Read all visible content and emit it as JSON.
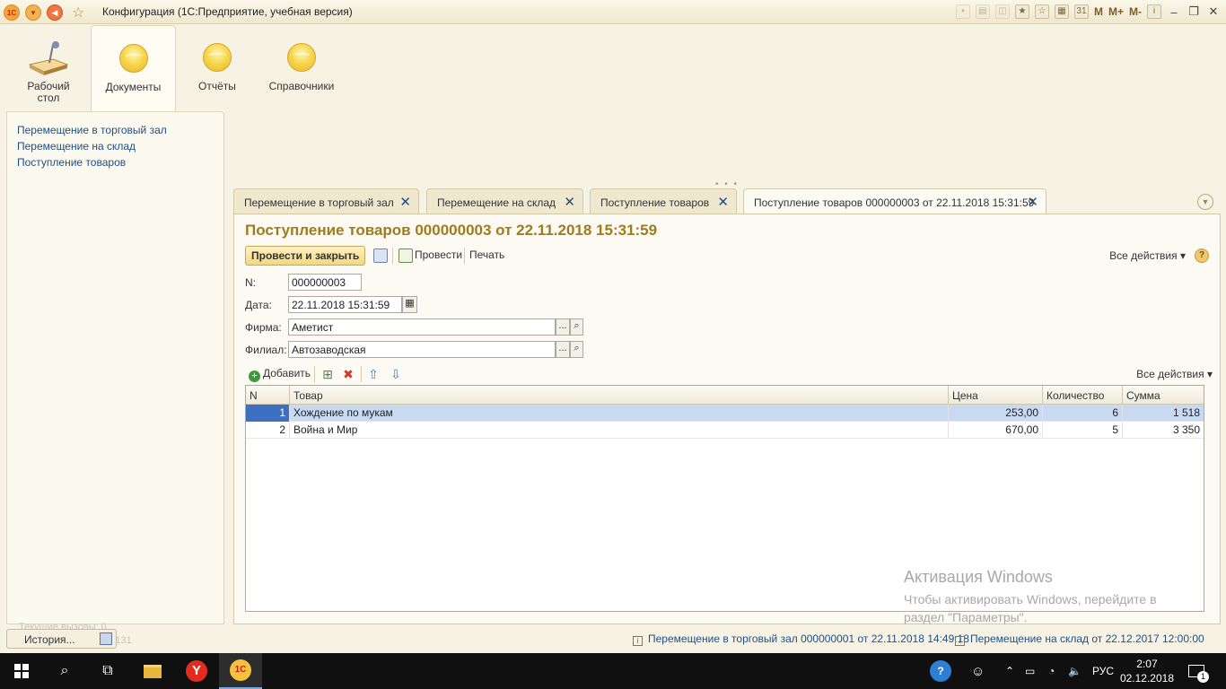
{
  "window": {
    "title": "Конфигурация  (1С:Предприятие, учебная версия)"
  },
  "toolbar_right": {
    "m": "M",
    "m_plus": "M+",
    "m_minus": "M-"
  },
  "sections": [
    {
      "label": "Рабочий стол"
    },
    {
      "label": "Документы"
    },
    {
      "label": "Отчёты"
    },
    {
      "label": "Справочники"
    }
  ],
  "nav_links": [
    "Перемещение в торговый зал",
    "Перемещение на склад",
    "Поступление товаров"
  ],
  "tabs": [
    "Перемещение в торговый зал",
    "Перемещение на склад",
    "Поступление товаров",
    "Поступление товаров 000000003 от 22.11.2018 15:31:59"
  ],
  "document": {
    "title": "Поступление товаров 000000003 от 22.11.2018 15:31:59",
    "commands": {
      "post_close": "Провести и закрыть",
      "post": "Провести",
      "print": "Печать",
      "all_actions": "Все действия ▾"
    },
    "fields": {
      "number_label": "N:",
      "number": "000000003",
      "date_label": "Дата:",
      "date": "22.11.2018 15:31:59",
      "firm_label": "Фирма:",
      "firm": "Аметист",
      "branch_label": "Филиал:",
      "branch": "Автозаводская"
    },
    "table_bar": {
      "add": "Добавить",
      "all_actions": "Все действия ▾"
    },
    "table": {
      "columns": [
        "N",
        "Товар",
        "Цена",
        "Количество",
        "Сумма"
      ],
      "rows": [
        {
          "n": "1",
          "product": "Хождение по мукам",
          "price": "253,00",
          "qty": "6",
          "sum": "1 518"
        },
        {
          "n": "2",
          "product": "Война и Мир",
          "price": "670,00",
          "qty": "5",
          "sum": "3 350"
        }
      ]
    }
  },
  "watermark": {
    "line1": "Активация Windows",
    "line2": "Чтобы активировать Windows, перейдите в",
    "line3": "раздел \"Параметры\"."
  },
  "statusbar": {
    "history": "История...",
    "history_faded1": "Текущие вызовы: 0",
    "history_faded2": "Накоплено вызовов: 131",
    "notif1": "Перемещение в торговый зал 000000001 от 22.11.2018 14:49:18",
    "notif2": "Перемещение на склад  от 22.12.2017 12:00:00"
  },
  "taskbar": {
    "lang": "РУС",
    "time": "2:07",
    "date": "02.12.2018",
    "notifications": "1"
  }
}
